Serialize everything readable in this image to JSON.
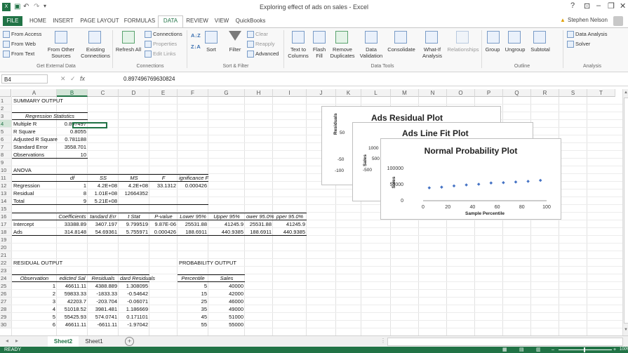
{
  "window": {
    "title": "Exploring effect of ads on sales - Excel",
    "user": "Stephen Nelson",
    "help": "?",
    "minimize": "–",
    "restore": "❐",
    "close": "✕"
  },
  "tabs": [
    "FILE",
    "HOME",
    "INSERT",
    "PAGE LAYOUT",
    "FORMULAS",
    "DATA",
    "REVIEW",
    "VIEW",
    "QuickBooks"
  ],
  "ribbon": {
    "get_external": {
      "items": [
        "From Access",
        "From Web",
        "From Text"
      ],
      "other": "From Other Sources",
      "existing": "Existing Connections",
      "label": "Get External Data"
    },
    "connections": {
      "refresh": "Refresh All",
      "items": [
        "Connections",
        "Properties",
        "Edit Links"
      ],
      "label": "Connections"
    },
    "sort_filter": {
      "sort": "Sort",
      "filter": "Filter",
      "items": [
        "Clear",
        "Reapply",
        "Advanced"
      ],
      "label": "Sort & Filter"
    },
    "data_tools": {
      "items": [
        "Text to Columns",
        "Flash Fill",
        "Remove Duplicates",
        "Data Validation",
        "Consolidate",
        "What-If Analysis",
        "Relationships"
      ],
      "label": "Data Tools"
    },
    "outline": {
      "items": [
        "Group",
        "Ungroup",
        "Subtotal"
      ],
      "label": "Outline"
    },
    "analysis": {
      "items": [
        "Data Analysis",
        "Solver"
      ],
      "label": "Analysis"
    }
  },
  "formula_bar": {
    "name_box": "B4",
    "fx": "fx",
    "value": "0.897496769630824"
  },
  "columns": [
    "A",
    "B",
    "C",
    "D",
    "E",
    "F",
    "G",
    "H",
    "I",
    "J",
    "K",
    "L",
    "M",
    "N",
    "O",
    "P",
    "Q",
    "R",
    "S",
    "T"
  ],
  "rows": [
    "1",
    "2",
    "3",
    "4",
    "5",
    "6",
    "7",
    "8",
    "9",
    "10",
    "11",
    "12",
    "13",
    "14",
    "15",
    "16",
    "17",
    "18",
    "19",
    "20",
    "21",
    "22",
    "23",
    "24",
    "25",
    "26",
    "27",
    "28",
    "29",
    "30"
  ],
  "summary": {
    "title": "SUMMARY OUTPUT",
    "reg_stats": "Regression Statistics",
    "labels": [
      "Multiple R",
      "R Square",
      "Adjusted R Square",
      "Standard Error",
      "Observations"
    ],
    "values": [
      "0.897497",
      "0.8055",
      "0.781188",
      "3558.701",
      "10"
    ]
  },
  "anova": {
    "title": "ANOVA",
    "headers": [
      "df",
      "SS",
      "MS",
      "F",
      "ignificance F"
    ],
    "rows": [
      {
        "label": "Regression",
        "df": "1",
        "ss": "4.2E+08",
        "ms": "4.2E+08",
        "f": "33.1312",
        "sig": "0.000426"
      },
      {
        "label": "Residual",
        "df": "8",
        "ss": "1.01E+08",
        "ms": "12664352",
        "f": "",
        "sig": ""
      },
      {
        "label": "Total",
        "df": "9",
        "ss": "5.21E+08",
        "ms": "",
        "f": "",
        "sig": ""
      }
    ]
  },
  "coef": {
    "headers": [
      "Coefficients",
      "tandard Err",
      "t Stat",
      "P-value",
      "Lower 95%",
      "Upper 95%",
      "ower 95.0%",
      "pper 95.0%"
    ],
    "rows": [
      {
        "label": "Intercept",
        "vals": [
          "33388.89",
          "3407.197",
          "9.799519",
          "9.87E-06",
          "25531.88",
          "41245.9",
          "25531.88",
          "41245.9"
        ]
      },
      {
        "label": "Ads",
        "vals": [
          "314.8148",
          "54.69361",
          "5.755971",
          "0.000426",
          "188.6911",
          "440.9385",
          "188.6911",
          "440.9385"
        ]
      }
    ]
  },
  "residual": {
    "title": "RESIDUAL OUTPUT",
    "headers": [
      "Observation",
      "edicted Sal",
      "Residuals",
      "dard Residuals"
    ],
    "rows": [
      [
        "1",
        "46611.11",
        "4388.889",
        "1.308095"
      ],
      [
        "2",
        "59833.33",
        "-1833.33",
        "-0.54642"
      ],
      [
        "3",
        "42203.7",
        "-203.704",
        "-0.06071"
      ],
      [
        "4",
        "51018.52",
        "3981.481",
        "1.186669"
      ],
      [
        "5",
        "55425.93",
        "574.0741",
        "0.171101"
      ],
      [
        "6",
        "46611.11",
        "-6611.11",
        "-1.97042"
      ]
    ]
  },
  "probability": {
    "title": "PROBABILITY OUTPUT",
    "headers": [
      "Percentile",
      "Sales"
    ],
    "rows": [
      [
        "5",
        "40000"
      ],
      [
        "15",
        "42000"
      ],
      [
        "25",
        "46000"
      ],
      [
        "35",
        "49000"
      ],
      [
        "45",
        "51000"
      ],
      [
        "55",
        "55000"
      ]
    ]
  },
  "charts": {
    "residual": {
      "title": "Ads  Residual Plot",
      "ylabel": "Residuals",
      "ticks": [
        "50",
        "-50",
        "-100"
      ]
    },
    "linefit": {
      "title": "Ads Line Fit  Plot",
      "ylabel": "Sales",
      "ticks": [
        "1000",
        "500",
        "-500"
      ]
    },
    "normal": {
      "title": "Normal Probability Plot",
      "ylabel": "Sales",
      "xlabel": "Sample Percentile"
    }
  },
  "chart_data": {
    "type": "scatter",
    "title": "Normal Probability Plot",
    "xlabel": "Sample Percentile",
    "ylabel": "Sales",
    "x": [
      5,
      15,
      25,
      35,
      45,
      55,
      65,
      75,
      85,
      95
    ],
    "y": [
      40000,
      42000,
      46000,
      49000,
      51000,
      55000,
      56000,
      58000,
      60000,
      63000
    ],
    "xlim": [
      0,
      100
    ],
    "ylim": [
      0,
      100000
    ],
    "xticks": [
      "0",
      "20",
      "40",
      "60",
      "80",
      "100"
    ],
    "yticks": [
      "0",
      "50000",
      "100000"
    ],
    "marker_color": "#4472c4"
  },
  "sheets": [
    "Sheet2",
    "Sheet1"
  ],
  "status": {
    "left": "READY",
    "zoom": "100%"
  }
}
